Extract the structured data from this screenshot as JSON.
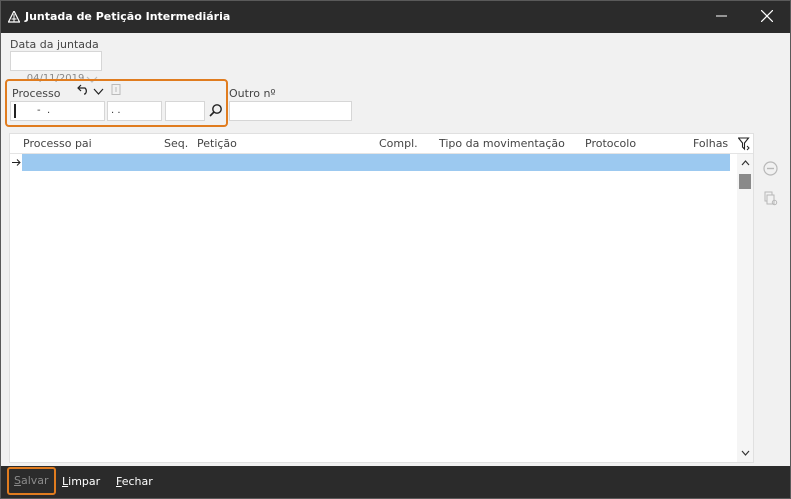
{
  "window": {
    "title": "Juntada de Petição Intermediária"
  },
  "form": {
    "data_label": "Data da juntada",
    "data_value": "04/11/2019",
    "processo_label": "Processo",
    "processo_part1": "-  .",
    "processo_part2": ". .",
    "processo_part3": "",
    "outro_label": "Outro nº",
    "outro_value": ""
  },
  "grid": {
    "columns": [
      "Processo pai",
      "Seq.",
      "Petição",
      "Compl.",
      "Tipo da movimentação",
      "Protocolo",
      "Folhas"
    ]
  },
  "actions": {
    "salvar_first": "S",
    "salvar_rest": "alvar",
    "limpar_first": "L",
    "limpar_rest": "impar",
    "fechar_first": "F",
    "fechar_rest": "echar"
  },
  "colors": {
    "accent_orange": "#e07c1f",
    "selection_blue": "#9cc9f0",
    "titlebar": "#2b2b2b"
  }
}
